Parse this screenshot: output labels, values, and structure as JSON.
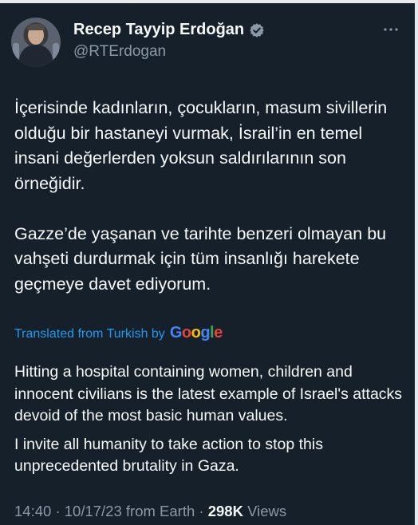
{
  "author": {
    "name": "Recep Tayyip Erdoğan",
    "handle": "@RTErdogan",
    "verified_icon": "verified-badge-icon"
  },
  "more_options_icon": "more-horizontal-icon",
  "tweet": {
    "paragraphs": [
      "İçerisinde kadınların, çocukların, masum sivillerin olduğu bir hastaneyi vurmak, İsrail’in en temel insani değerlerden yoksun saldırılarının son örneğidir.",
      "Gazze’de yaşanan ve tarihte benzeri olmayan bu vahşeti durdurmak için tüm insanlığı harekete geçmeye davet ediyorum."
    ]
  },
  "translation": {
    "label": "Translated from Turkish by",
    "provider": "Google",
    "paragraphs": [
      "Hitting a hospital containing women, children and innocent civilians is the latest example of Israel's attacks devoid of the most basic human values.",
      "I invite all humanity to take action to stop this unprecedented brutality in Gaza."
    ]
  },
  "meta": {
    "time": "14:40",
    "separator": "·",
    "date": "10/17/23",
    "source": "from Earth",
    "views_count": "298K",
    "views_label": "Views"
  },
  "colors": {
    "background": "#15202b",
    "text_primary": "#f7f9f9",
    "text_secondary": "#8b98a5",
    "link": "#1d9bf0"
  }
}
